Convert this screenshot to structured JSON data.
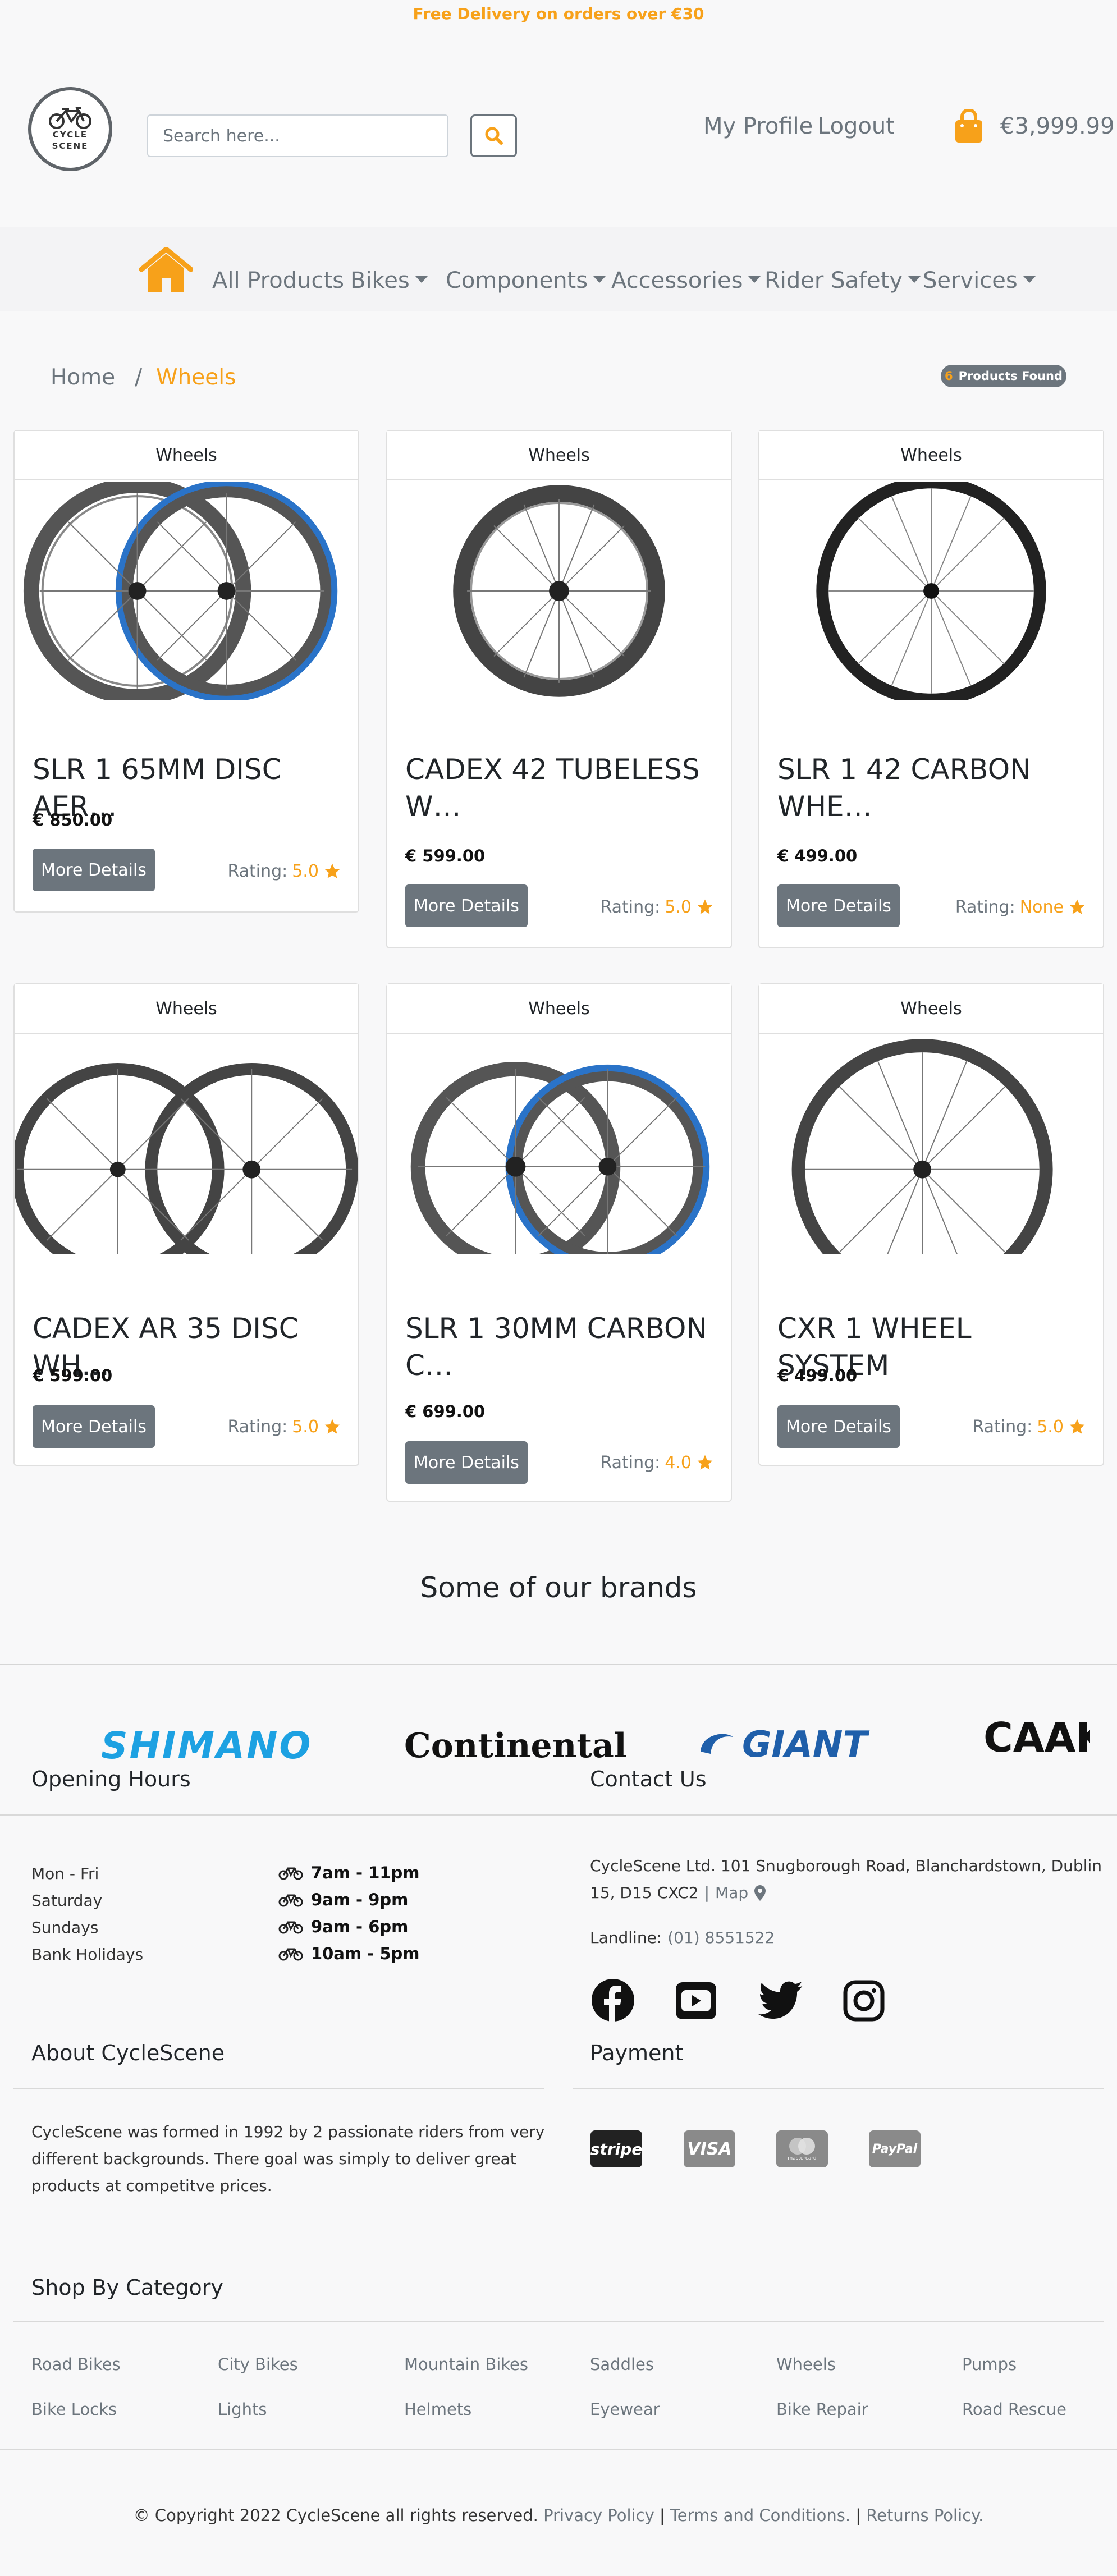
{
  "banner": "Free Delivery on orders over €30",
  "logo": {
    "line1": "CYCLE",
    "line2": "SCENE"
  },
  "header": {
    "search_placeholder": "Search here...",
    "my_profile": "My Profile",
    "logout": "Logout",
    "cart_total": "€3,999.99"
  },
  "nav": [
    "All Products",
    "Bikes",
    "Components",
    "Accessories",
    "Rider Safety",
    "Services"
  ],
  "breadcrumb": {
    "home": "Home",
    "separator": "/",
    "current": "Wheels"
  },
  "products_found": {
    "count": "6",
    "label": "Products Found"
  },
  "product_common": {
    "more_details": "More Details",
    "rating_label": "Rating:"
  },
  "products": [
    {
      "category": "Wheels",
      "title": "SLR 1 65MM DISC AER…",
      "price": "€ 850.00",
      "rating": "5.0"
    },
    {
      "category": "Wheels",
      "title": "CADEX 42 TUBELESS W…",
      "price": "€ 599.00",
      "rating": "5.0"
    },
    {
      "category": "Wheels",
      "title": "SLR 1 42 CARBON WHE…",
      "price": "€ 499.00",
      "rating": "None"
    },
    {
      "category": "Wheels",
      "title": "CADEX AR 35 DISC WH…",
      "price": "€ 599.00",
      "rating": "5.0"
    },
    {
      "category": "Wheels",
      "title": "SLR 1 30MM CARBON C…",
      "price": "€ 699.00",
      "rating": "4.0"
    },
    {
      "category": "Wheels",
      "title": "CXR 1 WHEEL SYSTEM",
      "price": "€ 499.00",
      "rating": "5.0"
    }
  ],
  "brands": {
    "title": "Some of our brands",
    "items": [
      "SHIMANO",
      "Continental",
      "GIANT",
      "CAAK"
    ]
  },
  "opening_hours": {
    "title": "Opening Hours",
    "rows": [
      {
        "day": "Mon - Fri",
        "time": "7am - 11pm"
      },
      {
        "day": "Saturday",
        "time": "9am - 9pm"
      },
      {
        "day": "Sundays",
        "time": "9am - 6pm"
      },
      {
        "day": "Bank Holidays",
        "time": "10am - 5pm"
      }
    ]
  },
  "contact": {
    "title": "Contact Us",
    "address_line1": "CycleScene Ltd. 101 Snugborough Road, Blanchardstown, Dublin",
    "address_line2": "15, D15 CXC2",
    "map_label": "Map",
    "landline_label": "Landline:",
    "landline": "(01) 8551522"
  },
  "about": {
    "title": "About CycleScene",
    "line1": "CycleScene was formed in 1992 by 2 passionate riders from very",
    "line2": "different backgrounds. There goal was simply to deliver great",
    "line3": "products at competitve prices."
  },
  "payment": {
    "title": "Payment",
    "methods": [
      "stripe",
      "VISA",
      "mastercard",
      "PayPal"
    ]
  },
  "categories": {
    "title": "Shop By Category",
    "row1": [
      "Road Bikes",
      "City Bikes",
      "Mountain Bikes",
      "Saddles",
      "Wheels",
      "Pumps"
    ],
    "row2": [
      "Bike Locks",
      "Lights",
      "Helmets",
      "Eyewear",
      "Bike Repair",
      "Road Rescue"
    ]
  },
  "footer": {
    "copyright": "© Copyright 2022 CycleScene all rights reserved.",
    "privacy": "Privacy Policy",
    "terms": "Terms and Conditions.",
    "returns": "Returns Policy."
  },
  "colors": {
    "accent": "#f7a11a",
    "muted": "#6c757d",
    "shimano": "#1da1e2",
    "giant": "#1f5faa"
  }
}
